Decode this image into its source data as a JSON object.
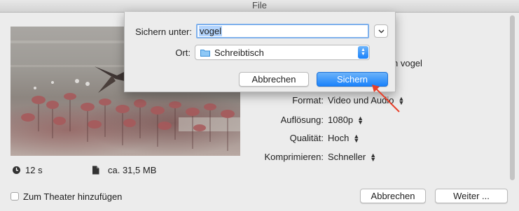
{
  "window": {
    "title": "File"
  },
  "video": {
    "duration": "12 s",
    "size": "ca. 31,5 MB"
  },
  "background_text": {
    "partial_name": "n vogel"
  },
  "properties": [
    {
      "label": "Format:",
      "value": "Video und Audio"
    },
    {
      "label": "Auflösung:",
      "value": "1080p"
    },
    {
      "label": "Qualität:",
      "value": "Hoch"
    },
    {
      "label": "Komprimieren:",
      "value": "Schneller"
    }
  ],
  "footer": {
    "checkbox_label": "Zum Theater hinzufügen",
    "checkbox_checked": false,
    "cancel_label": "Abbrechen",
    "next_label": "Weiter ..."
  },
  "save_sheet": {
    "save_as_label": "Sichern unter:",
    "filename": "vogel",
    "location_label": "Ort:",
    "location_value": "Schreibtisch",
    "cancel_label": "Abbrechen",
    "save_label": "Sichern"
  },
  "colors": {
    "accent": "#1a82fb",
    "annotation_arrow": "#e8402a",
    "folder": "#5aaef0"
  },
  "icons": {
    "duration": "clock-icon",
    "size": "document-icon",
    "location": "folder-icon",
    "disclosure": "chevron-down-icon"
  }
}
